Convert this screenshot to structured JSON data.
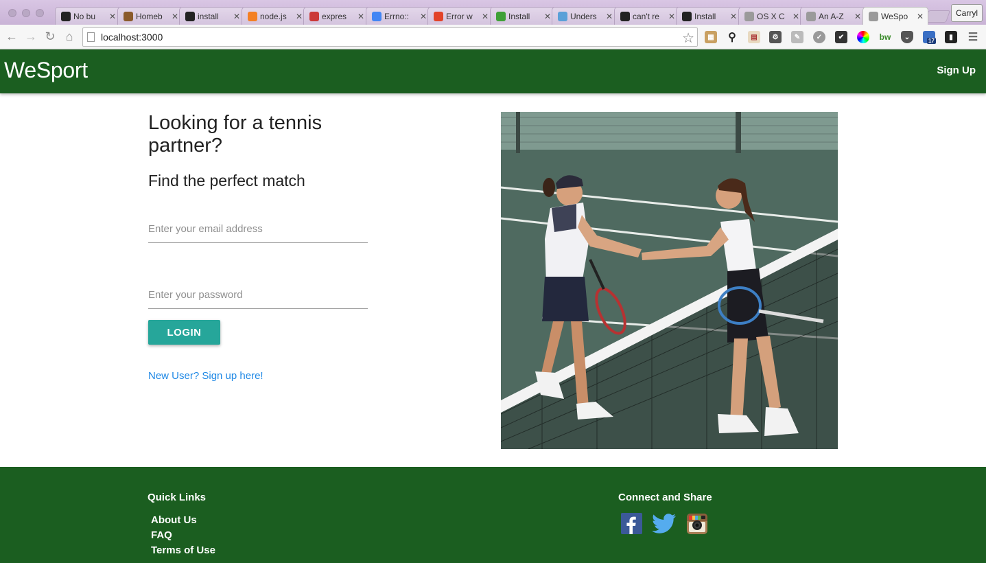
{
  "browser": {
    "tabs": [
      {
        "title": "No bu",
        "icon": "github-icon",
        "color": "#222222"
      },
      {
        "title": "Homeb",
        "icon": "homebrew-icon",
        "color": "#8a5a2b"
      },
      {
        "title": "install",
        "icon": "github-icon",
        "color": "#222222"
      },
      {
        "title": "node.js",
        "icon": "stackoverflow-icon",
        "color": "#f48024"
      },
      {
        "title": "expres",
        "icon": "npm-icon",
        "color": "#cb3837"
      },
      {
        "title": "Errno::",
        "icon": "google-icon",
        "color": "#4285f4"
      },
      {
        "title": "Error w",
        "icon": "gitlab-icon",
        "color": "#e24329"
      },
      {
        "title": "Install",
        "icon": "mongodb-icon",
        "color": "#3fa037"
      },
      {
        "title": "Unders",
        "icon": "cloud-icon",
        "color": "#5aa0d8"
      },
      {
        "title": "can't re",
        "icon": "github-icon",
        "color": "#222222"
      },
      {
        "title": "Install",
        "icon": "github-icon",
        "color": "#222222"
      },
      {
        "title": "OS X C",
        "icon": "page-icon",
        "color": "#9a9a9a"
      },
      {
        "title": "An A-Z",
        "icon": "page-icon",
        "color": "#9a9a9a"
      },
      {
        "title": "WeSpo",
        "icon": "page-icon",
        "color": "#9a9a9a",
        "active": true
      }
    ],
    "profile_name": "Carryl",
    "url": "localhost:3000",
    "extension_badge": "17"
  },
  "header": {
    "brand": "WeSport",
    "signup_label": "Sign Up"
  },
  "main": {
    "headline": "Looking for a tennis partner?",
    "subheadline": "Find the perfect match",
    "email_placeholder": "Enter your email address",
    "password_placeholder": "Enter your password",
    "login_label": "LOGIN",
    "new_user_link": "New User? Sign up here!"
  },
  "footer": {
    "quick_links_title": "Quick Links",
    "quick_links": [
      "About Us",
      "FAQ",
      "Terms of Use"
    ],
    "connect_title": "Connect and Share",
    "social_icons": [
      "facebook-icon",
      "twitter-icon",
      "instagram-icon"
    ]
  },
  "colors": {
    "header_green": "#1b5e20",
    "login_teal": "#26a69a",
    "link_blue": "#1e88e5"
  }
}
